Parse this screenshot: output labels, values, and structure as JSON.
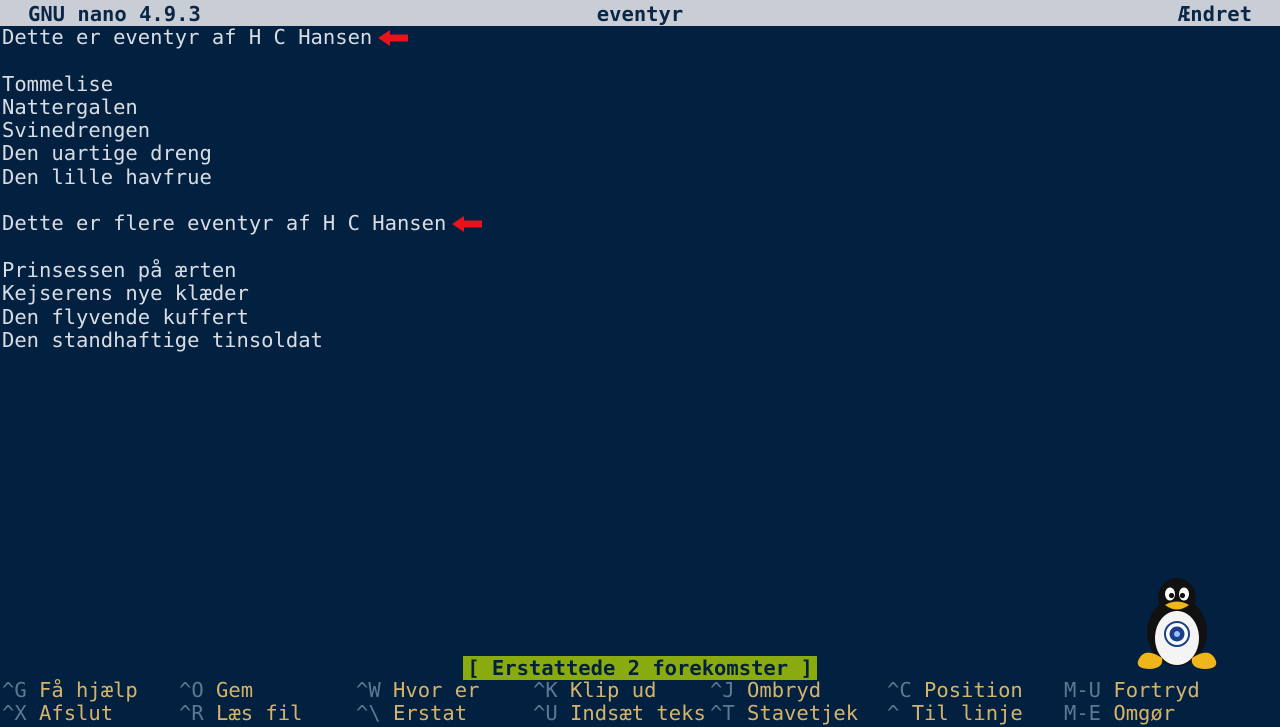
{
  "titlebar": {
    "app": "GNU nano 4.9.3",
    "filename": "eventyr",
    "state": "Ændret"
  },
  "editor_lines": [
    "Dette er eventyr af H C Hansen",
    "",
    "Tommelise",
    "Nattergalen",
    "Svinedrengen",
    "Den uartige dreng",
    "Den lille havfrue",
    "",
    "Dette er flere eventyr af H C Hansen",
    "",
    "Prinsessen på ærten",
    "Kejserens nye klæder",
    "Den flyvende kuffert",
    "Den standhaftige tinsoldat"
  ],
  "status_message": "[ Erstattede 2 forekomster ]",
  "shortcuts_row1": [
    {
      "key": "^G",
      "label": "Få hjælp"
    },
    {
      "key": "^O",
      "label": "Gem"
    },
    {
      "key": "^W",
      "label": "Hvor er"
    },
    {
      "key": "^K",
      "label": "Klip ud"
    },
    {
      "key": "^J",
      "label": "Ombryd"
    },
    {
      "key": "^C",
      "label": "Position"
    },
    {
      "key": "M-U",
      "label": "Fortryd"
    }
  ],
  "shortcuts_row2": [
    {
      "key": "^X",
      "label": "Afslut"
    },
    {
      "key": "^R",
      "label": "Læs fil"
    },
    {
      "key": "^\\",
      "label": "Erstat"
    },
    {
      "key": "^U",
      "label": "Indsæt teks"
    },
    {
      "key": "^T",
      "label": "Stavetjek"
    },
    {
      "key": "^",
      "label": "Til linje"
    },
    {
      "key": "M-E",
      "label": "Omgør"
    }
  ],
  "colors": {
    "background": "#02203f",
    "titlebar": "#c9ced6",
    "status_bg": "#8aab10",
    "shortcut_key": "#5e7893",
    "shortcut_label": "#d5b36a",
    "annotation_arrow": "#e8141c"
  },
  "icons": {
    "annotation": "red-left-arrow-icon",
    "mascot": "tux-penguin-logo"
  }
}
